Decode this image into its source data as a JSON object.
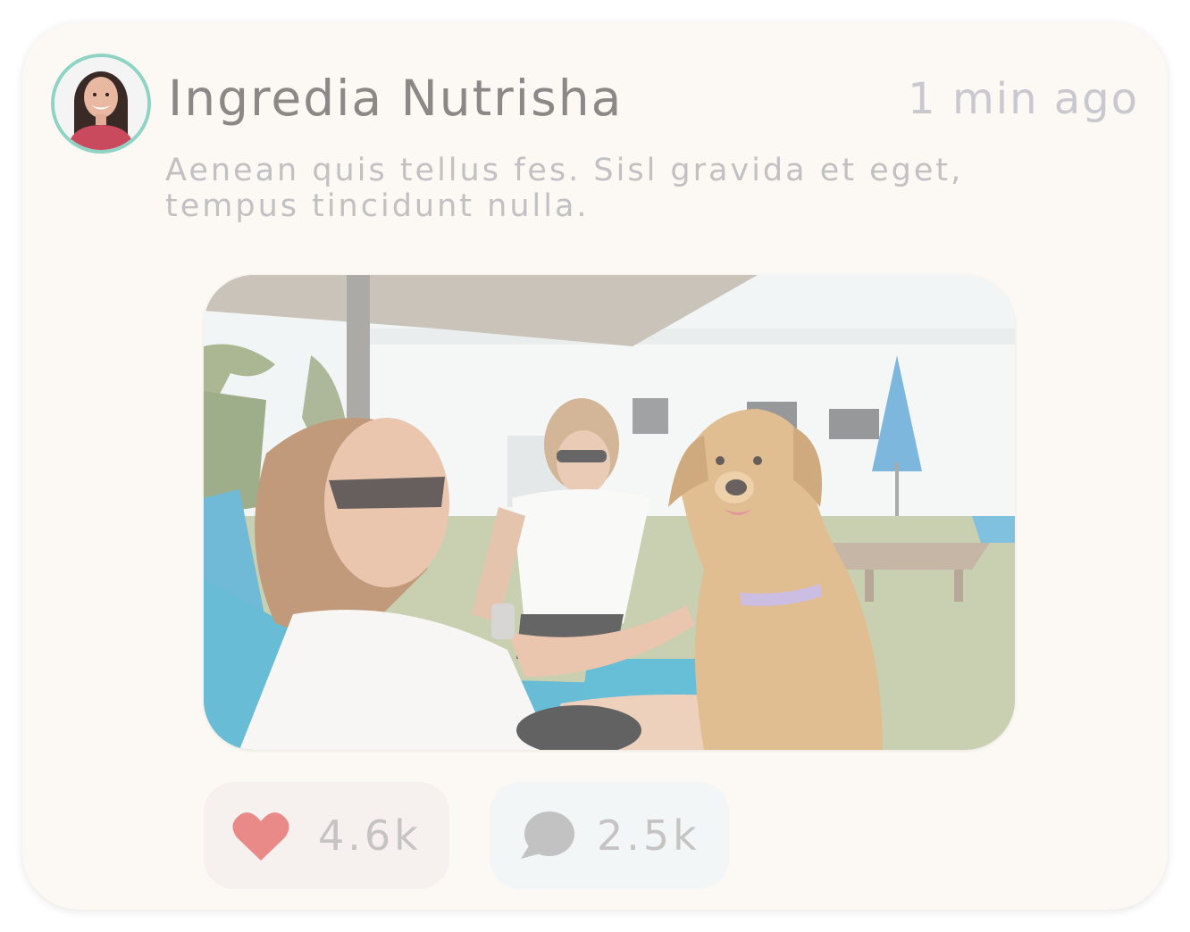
{
  "post": {
    "author": "Ingredia Nutrisha",
    "time": "1 min ago",
    "text": "Aenean quis tellus fes. Sisl gravida et eget, tempus tincidunt nulla.",
    "avatar_icon": "woman-portrait",
    "image_subject": "two-women-and-golden-retriever-on-patio"
  },
  "actions": {
    "likes": "4.6k",
    "comments": "2.5k",
    "like_icon": "heart-icon",
    "comment_icon": "speech-bubble-icon"
  },
  "colors": {
    "card_bg": "#fcf8f4",
    "avatar_ring": "#8ed3c4",
    "heart": "#e98a88",
    "comment_icon": "#c2c2c2",
    "like_bg": "#f6f0ee",
    "comment_bg": "#f3f6f6"
  }
}
